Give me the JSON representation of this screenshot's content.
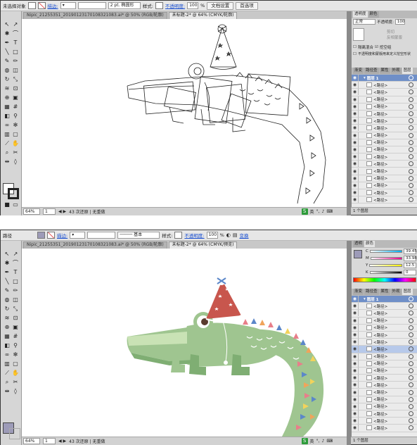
{
  "top": {
    "ctrl": {
      "selection_label": "未选择对象",
      "stroke_label": "描边:",
      "stroke_width": "2 pt. 椭圆形",
      "style_label": "样式:",
      "opacity_label": "不透明度:",
      "opacity_value": "100",
      "opacity_unit": "%",
      "doc_setup": "文档设置",
      "preferences": "首选项"
    },
    "tabs": [
      "Nipic_21255351_20190123170108321083.ai* @ 50% (RGB/轮廓)",
      "未标题-2* @ 64% (CMYK/轮廓)"
    ],
    "status": {
      "zoom": "64%",
      "page": "1",
      "info": "43 次还原 | 无重做"
    },
    "transparency": {
      "tabs": [
        "透明度",
        "颜色"
      ],
      "mode": "正常",
      "opacity_label": "不透明度:",
      "opacity_value": "100",
      "clip_label": "剪切",
      "invert_label": "反相蒙版",
      "isolate_label": "隔离混合",
      "knockout_label": "挖空组",
      "define_label": "不透明度和蒙版用来定义挖空形状"
    },
    "layers": {
      "tabs": [
        "渐变",
        "路径查",
        "属性",
        "外观",
        "图层"
      ],
      "layer_name": "图层 1",
      "items": [
        "<路径>",
        "<路径>",
        "<路径>",
        "<路径>",
        "<路径>",
        "<路径>",
        "<路径>",
        "<路径>",
        "<路径>",
        "<路径>",
        "<路径>",
        "<路径>",
        "<路径>",
        "<路径>",
        "<路径>",
        "<路径>",
        "<路径>"
      ],
      "footer": "1 个图层"
    },
    "ime_label": "英"
  },
  "bottom": {
    "ctrl": {
      "selection_label": "路径",
      "stroke_label": "描边:",
      "brush_label": "基本",
      "style_label": "样式:",
      "opacity_label": "不透明度:",
      "opacity_value": "100",
      "opacity_unit": "%",
      "transform": "变换"
    },
    "tabs": [
      "Nipic_21255351_20190123170108321083.ai* @ 50% (RGB/轮廓)",
      "未标题-2* @ 64% (CMYK/预览)"
    ],
    "status": {
      "zoom": "64%",
      "page": "1",
      "info": "43 次还原 | 无重做"
    },
    "color": {
      "tabs": [
        "透明",
        "颜色"
      ],
      "channels": [
        {
          "label": "C",
          "value": "39.45"
        },
        {
          "label": "M",
          "value": "33.98"
        },
        {
          "label": "Y",
          "value": "12.5"
        },
        {
          "label": "K",
          "value": "0"
        }
      ],
      "fill_color": "#9d9bb8"
    },
    "layers": {
      "tabs": [
        "渐变",
        "路径查",
        "属性",
        "外观",
        "图层"
      ],
      "layer_name": "图层 1",
      "items": [
        "<路径>",
        "<路径>",
        "<路径>",
        "<路径>",
        "<路径>",
        "<路径>",
        "<路径>",
        "<路径>",
        "<路径>",
        "<路径>",
        "<路径>",
        "<路径>",
        "<路径>",
        "<路径>",
        "<路径>",
        "<路径>",
        "<路径>",
        "<路径>"
      ],
      "footer": "1 个图层"
    },
    "ime_label": "英"
  },
  "colors": {
    "crocodile_body": "#9fc590",
    "crocodile_dark": "#7fae73",
    "crocodile_light": "#c9e2b5",
    "hat_red": "#c8564d",
    "bunting_pink": "#e87f8a",
    "bunting_blue": "#5b87c9",
    "bunting_orange": "#f0a45b",
    "bunting_yellow": "#f2d35b",
    "ime_green": "#2d9b3a",
    "layer_header_blue": "#6f8fc8",
    "selection_link_blue": "#1a4fd0"
  },
  "icons": {
    "eye": "eye-icon",
    "target": "target-circle-icon",
    "ime": "sogou-ime-icon"
  }
}
